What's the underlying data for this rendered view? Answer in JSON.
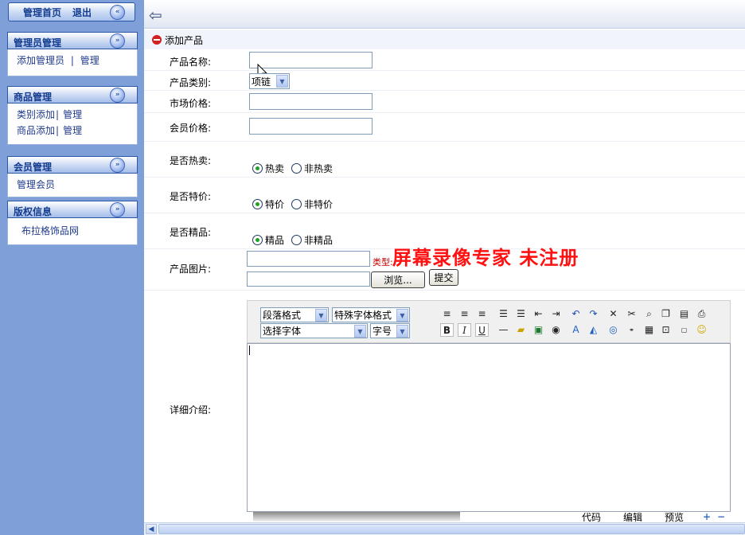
{
  "sidebar": {
    "top": {
      "home": "管理首页",
      "logout": "退出",
      "collapse_glyph": "«"
    },
    "panels": [
      {
        "title": "管理员管理",
        "items": [
          {
            "label": "添加管理员",
            "sep": "|",
            "link": "管理"
          }
        ]
      },
      {
        "title": "商品管理",
        "items": [
          {
            "label": "类别添加",
            "sep": "|",
            "link": "管理"
          },
          {
            "label": "商品添加",
            "sep": "|",
            "link": "管理"
          }
        ]
      },
      {
        "title": "会员管理",
        "items": [
          {
            "label": "管理会员"
          }
        ]
      },
      {
        "title": "版权信息",
        "items": [
          {
            "label": "布拉格饰品网"
          }
        ]
      }
    ],
    "panel_glyph": "»"
  },
  "header": {
    "back_icon": "back-arrow-icon"
  },
  "form": {
    "title": "添加产品",
    "name_label": "产品名称:",
    "category_label": "产品类别:",
    "category_value": "项链",
    "market_price_label": "市场价格:",
    "member_price_label": "会员价格:",
    "hot_label": "是否热卖:",
    "hot_yes": "热卖",
    "hot_no": "非热卖",
    "special_label": "是否特价:",
    "special_yes": "特价",
    "special_no": "非特价",
    "premium_label": "是否精品:",
    "premium_yes": "精品",
    "premium_no": "非精品",
    "image_label": "产品图片:",
    "image_type_hint": "类型:",
    "browse_button": "浏览...",
    "submit_button": "提交",
    "detail_label": "详细介绍:"
  },
  "editor": {
    "paragraph_format": "段落格式",
    "special_font_format": "特殊字体格式",
    "font_select": "选择字体",
    "font_size": "字号",
    "tab_code": "代码",
    "tab_edit": "编辑",
    "tab_preview": "预览"
  },
  "watermark": "屏幕录像专家  未注册"
}
